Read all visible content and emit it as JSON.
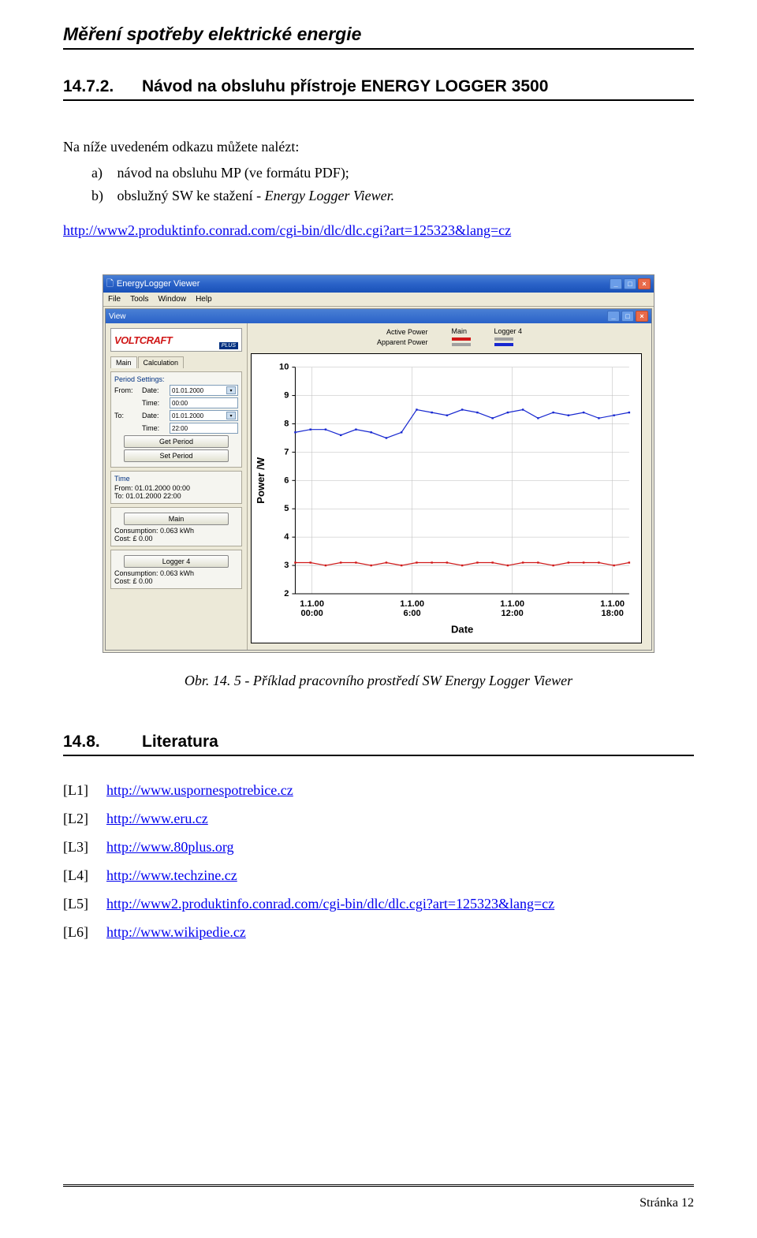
{
  "doc_title": "Měření spotřeby elektrické energie",
  "section1": {
    "num": "14.7.2.",
    "title": "Návod na obsluhu přístroje ENERGY LOGGER 3500"
  },
  "intro": "Na níže uvedeném odkazu můžete nalézt:",
  "list_a": {
    "label": "a)",
    "text": "návod na obsluhu MP (ve formátu PDF);"
  },
  "list_b": {
    "label": "b)",
    "text": "obslužný SW ke stažení - ",
    "italic": "Energy Logger Viewer."
  },
  "main_link": "http://www2.produktinfo.conrad.com/cgi-bin/dlc/dlc.cgi?art=125323&lang=cz",
  "screenshot": {
    "app_title": "EnergyLogger Viewer",
    "menu": [
      "File",
      "Tools",
      "Window",
      "Help"
    ],
    "view_title": "View",
    "logo": "VOLTCRAFT",
    "logo_plus": "PLUS",
    "tabs": [
      "Main",
      "Calculation"
    ],
    "period_settings_title": "Period Settings:",
    "from_label": "From:",
    "to_label": "To:",
    "date_label": "Date:",
    "time_label": "Time:",
    "from_date": "01.01.2000",
    "from_time": "00:00",
    "to_date": "01.01.2000",
    "to_time": "22:00",
    "btn_get": "Get Period",
    "btn_set": "Set Period",
    "time_group_title": "Time",
    "time_from": "From: 01.01.2000 00:00",
    "time_to": "To: 01.01.2000 22:00",
    "main_btn": "Main",
    "main_cons": "Consumption: 0.063 kWh",
    "main_cost": "Cost: £ 0.00",
    "logger_btn": "Logger 4",
    "logger_cons": "Consumption: 0.063 kWh",
    "logger_cost": "Cost: £ 0.00",
    "legend_main": "Main",
    "legend_logger": "Logger 4",
    "legend_active": "Active Power",
    "legend_apparent": "Apparent Power"
  },
  "chart_data": {
    "type": "line",
    "ylabel": "Power /W",
    "xlabel": "Date",
    "ylim": [
      2,
      10
    ],
    "yticks": [
      2,
      3,
      4,
      5,
      6,
      7,
      8,
      9,
      10
    ],
    "xticks": [
      "1.1.00\n00:00",
      "1.1.00\n6:00",
      "1.1.00\n12:00",
      "1.1.00\n18:00"
    ],
    "series": [
      {
        "name": "Logger 4 (Apparent)",
        "color": "#1828d0",
        "values": [
          7.7,
          7.8,
          7.8,
          7.6,
          7.8,
          7.7,
          7.5,
          7.7,
          8.5,
          8.4,
          8.3,
          8.5,
          8.4,
          8.2,
          8.4,
          8.5,
          8.2,
          8.4,
          8.3,
          8.4,
          8.2,
          8.3,
          8.4
        ]
      },
      {
        "name": "Main (Active)",
        "color": "#d01818",
        "values": [
          3.1,
          3.1,
          3.0,
          3.1,
          3.1,
          3.0,
          3.1,
          3.0,
          3.1,
          3.1,
          3.1,
          3.0,
          3.1,
          3.1,
          3.0,
          3.1,
          3.1,
          3.0,
          3.1,
          3.1,
          3.1,
          3.0,
          3.1
        ]
      }
    ]
  },
  "caption": "Obr. 14. 5 - Příklad pracovního prostředí SW Energy Logger Viewer",
  "section2": {
    "num": "14.8.",
    "title": "Literatura"
  },
  "refs": [
    {
      "label": "[L1]",
      "url": "http://www.uspornespotrebice.cz"
    },
    {
      "label": "[L2]",
      "url": "http://www.eru.cz"
    },
    {
      "label": "[L3]",
      "url": "http://www.80plus.org"
    },
    {
      "label": "[L4]",
      "url": "http://www.techzine.cz"
    },
    {
      "label": "[L5]",
      "url": "http://www2.produktinfo.conrad.com/cgi-bin/dlc/dlc.cgi?art=125323&lang=cz"
    },
    {
      "label": "[L6]",
      "url": "http://www.wikipedie.cz"
    }
  ],
  "page_number": "Stránka 12"
}
